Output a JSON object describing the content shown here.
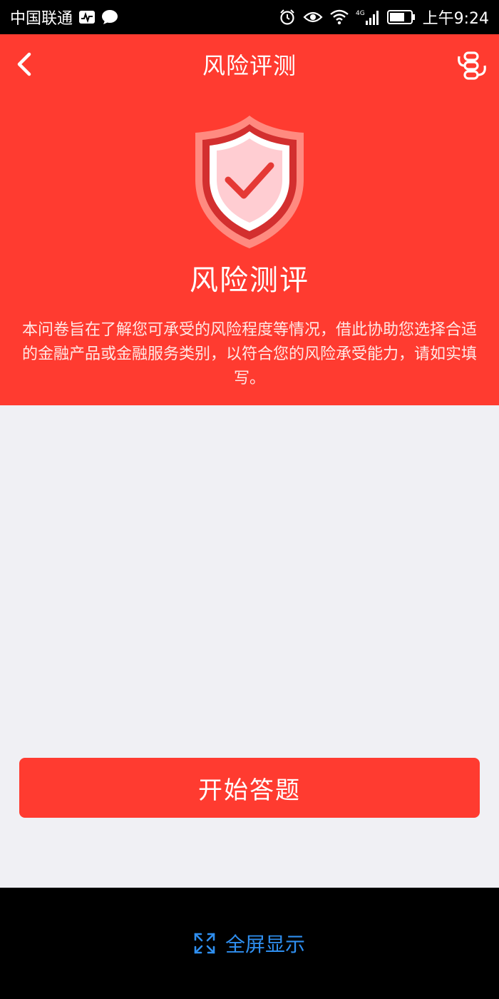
{
  "status_bar": {
    "carrier": "中国联通",
    "time": "上午9:24",
    "network": "4G",
    "icons": [
      "activity-icon",
      "chat-bubble-icon",
      "alarm-icon",
      "eye-icon",
      "wifi-icon",
      "signal-icon",
      "battery-icon"
    ]
  },
  "nav": {
    "title": "风险评测",
    "back_icon": "back-arrow-icon",
    "share_icon": "share-link-icon"
  },
  "hero": {
    "icon": "shield-check-icon",
    "title": "风险测评",
    "description": "本问卷旨在了解您可承受的风险程度等情况，借此协助您选择合适的金融产品或金融服务类别，以符合您的风险承受能力，请如实填写。"
  },
  "actions": {
    "start_label": "开始答题"
  },
  "bottom_bar": {
    "fullscreen_label": "全屏显示",
    "fullscreen_icon": "fullscreen-expand-icon"
  },
  "colors": {
    "primary_red": "#ff3b30",
    "background": "#f0f0f4",
    "link_blue": "#2f8ff0"
  }
}
